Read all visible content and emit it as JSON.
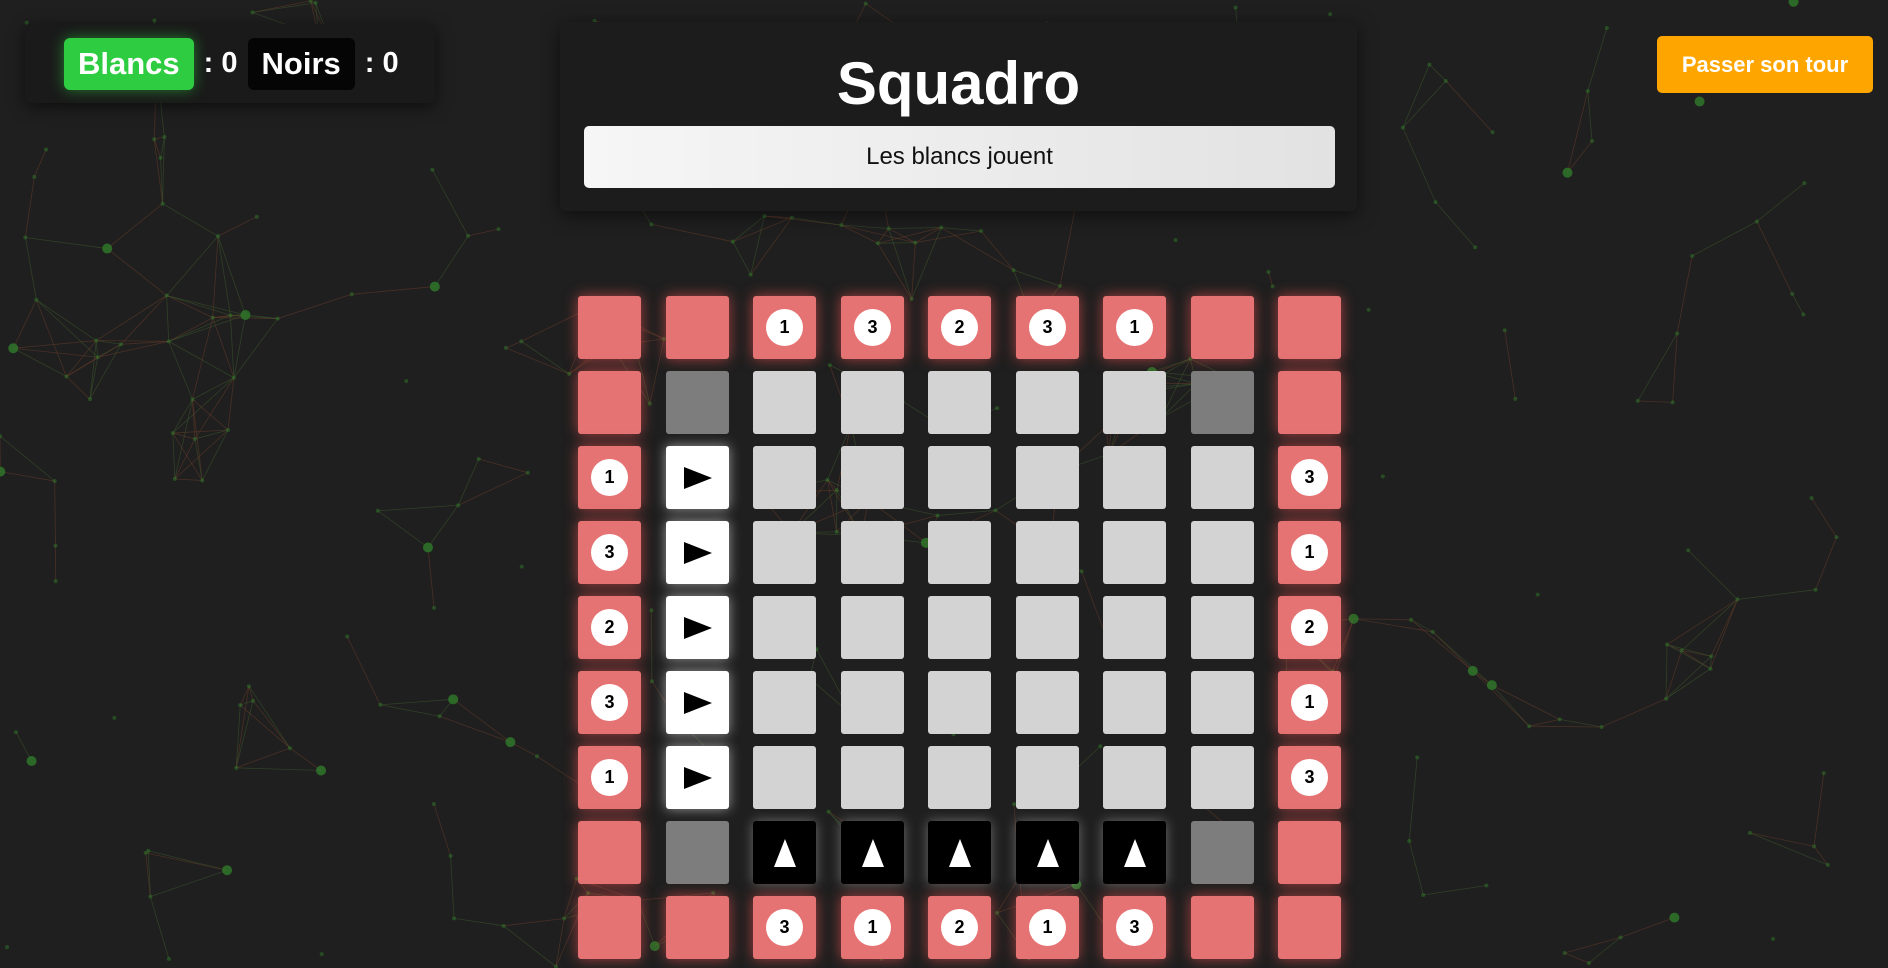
{
  "scoreboard": {
    "white_label": "Blancs",
    "white_score": ": 0",
    "black_label": "Noirs",
    "black_score": ": 0"
  },
  "title": "Squadro",
  "status": "Les blancs jouent",
  "pass_button": "Passer son tour",
  "colors": {
    "red_cell": "#e57373",
    "light_cell": "#d3d3d3",
    "dark_cell": "#7d7d7d",
    "white_badge": "#2ecc40",
    "pass_button": "#ffa500"
  },
  "board": {
    "size": 9,
    "legend": "R = red border cell, L = light track cell, D = dark corner cell, W = white piece (arrow right), B = black piece (arrow up); numbers are speed badges on red cells",
    "rows": [
      [
        "R",
        "R",
        "R1",
        "R3",
        "R2",
        "R3",
        "R1",
        "R",
        "R"
      ],
      [
        "R",
        "D",
        "L",
        "L",
        "L",
        "L",
        "L",
        "D",
        "R"
      ],
      [
        "R1",
        "W",
        "L",
        "L",
        "L",
        "L",
        "L",
        "L",
        "R3"
      ],
      [
        "R3",
        "W",
        "L",
        "L",
        "L",
        "L",
        "L",
        "L",
        "R1"
      ],
      [
        "R2",
        "W",
        "L",
        "L",
        "L",
        "L",
        "L",
        "L",
        "R2"
      ],
      [
        "R3",
        "W",
        "L",
        "L",
        "L",
        "L",
        "L",
        "L",
        "R1"
      ],
      [
        "R1",
        "W",
        "L",
        "L",
        "L",
        "L",
        "L",
        "L",
        "R3"
      ],
      [
        "R",
        "D",
        "B",
        "B",
        "B",
        "B",
        "B",
        "D",
        "R"
      ],
      [
        "R",
        "R",
        "R3",
        "R1",
        "R2",
        "R1",
        "R3",
        "R",
        "R"
      ]
    ]
  }
}
